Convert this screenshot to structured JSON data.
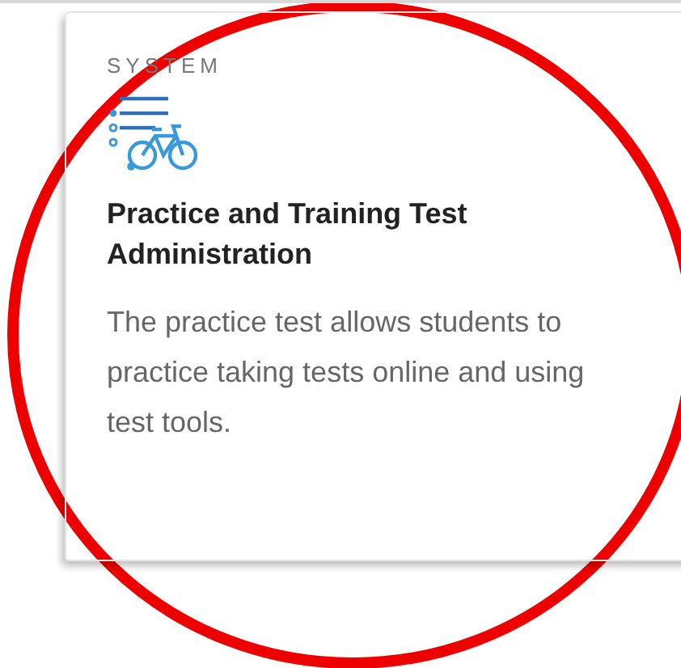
{
  "card": {
    "category": "SYSTEM",
    "title": "Practice and Training Test Administration",
    "description": "The practice test allows students to practice taking tests online and using test tools."
  }
}
